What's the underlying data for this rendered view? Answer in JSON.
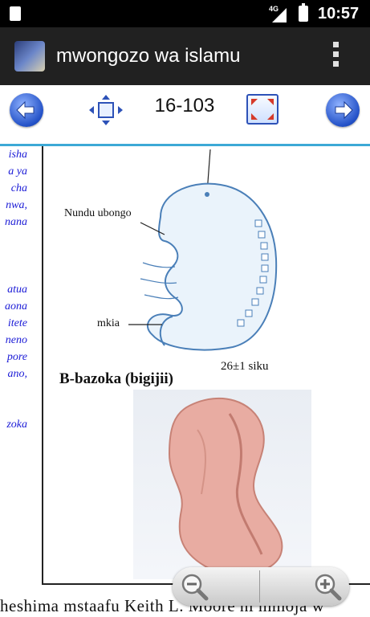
{
  "status_bar": {
    "network": "4G",
    "time": "10:57"
  },
  "app": {
    "title": "mwongozo wa islamu"
  },
  "toolbar": {
    "page": "16-103"
  },
  "side_text": [
    "isha",
    "a ya",
    "cha",
    "nwa,",
    "nana",
    "",
    "",
    "",
    "atua",
    "aona",
    "itete",
    "neno",
    "pore",
    "ano,",
    "",
    "",
    "zoka"
  ],
  "figure": {
    "label_nundu": "Nundu ubongo",
    "label_mkia": "mkia",
    "label_siku": "26±1 siku",
    "caption": "B-bazoka (bigijii)"
  },
  "bottom_text": "heshima mstaafu Keith L. Moore ni mmoja w",
  "colors": {
    "accent": "#3da9d6",
    "appbar": "#212121",
    "side_text": "#1a1ad6"
  },
  "icons": {
    "back": "arrow-left-icon",
    "move": "move-arrows-icon",
    "fullscreen": "fullscreen-icon",
    "forward": "arrow-right-icon",
    "zoom_out": "zoom-out-icon",
    "zoom_in": "zoom-in-icon"
  }
}
